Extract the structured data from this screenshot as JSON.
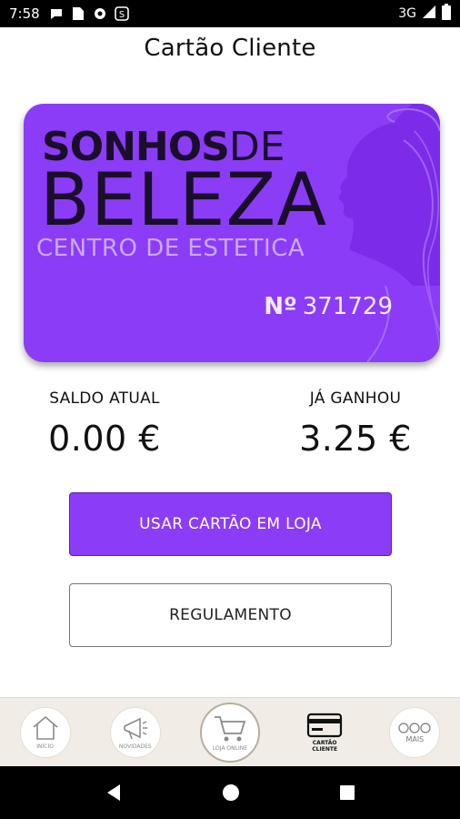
{
  "status_bar": {
    "time": "7:58",
    "network": "3G",
    "icons": [
      "chat-icon",
      "sim-icon",
      "settings-icon",
      "app-s-icon",
      "signal-icon",
      "battery-icon"
    ]
  },
  "header": {
    "title": "Cartão Cliente"
  },
  "card": {
    "brand_line1_bold": "SONHOS",
    "brand_line1_light": "DE",
    "brand_line2": "BELEZA",
    "brand_line3": "CENTRO DE ESTETICA",
    "number_prefix": "Nº",
    "number": "371729",
    "color": "#8b3cf7"
  },
  "balances": {
    "current_label": "SALDO ATUAL",
    "current_value": "0.00 €",
    "earned_label": "JÁ GANHOU",
    "earned_value": "3.25 €"
  },
  "actions": {
    "use_card_label": "USAR CARTÃO EM LOJA",
    "rules_label": "REGULAMENTO"
  },
  "bottom_nav": {
    "items": [
      {
        "label": "INÍCIO",
        "icon": "home-icon"
      },
      {
        "label": "NOVIDADES",
        "icon": "megaphone-icon"
      },
      {
        "label": "LOJA ONLINE",
        "icon": "cart-icon"
      },
      {
        "label": "CARTÃO CLIENTE",
        "icon": "card-icon",
        "active": true
      },
      {
        "label": "MAIS",
        "icon": "more-icon"
      }
    ]
  },
  "system_nav": {
    "icons": [
      "back-icon",
      "home-circle-icon",
      "recents-icon"
    ]
  }
}
